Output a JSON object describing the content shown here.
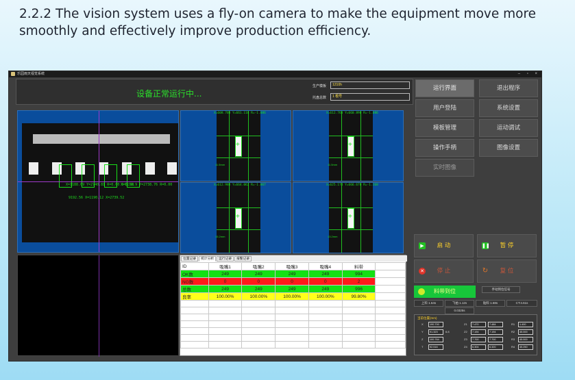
{
  "slide": {
    "heading": "2.2.2 The vision system uses a fly-on camera to make the equipment move more smoothly and effectively improve production efficiency."
  },
  "app": {
    "title": "乐园雨天视觉系统",
    "window_controls": "– ▫ ×",
    "status": "设备正常运行中...",
    "fields": [
      {
        "label": "生产模板",
        "value": "1210h"
      },
      {
        "label": "托盘总数",
        "value": "1 根号"
      }
    ],
    "nav": [
      {
        "label": "运行界面",
        "active": true
      },
      {
        "label": "退出程序"
      },
      {
        "label": "用户登陆"
      },
      {
        "label": "系统设置"
      },
      {
        "label": "模板管理"
      },
      {
        "label": "运动调试"
      },
      {
        "label": "操作手柄"
      },
      {
        "label": "图像设置"
      },
      {
        "label": "实时图像",
        "disabled": true
      }
    ],
    "main_camera": {
      "readout_a": "X=1188.09 Y=2740.81 R=0.00 S=0.98",
      "readout_b": "X=1219.9 Y=2738.76 R=0.00",
      "readout_c": "9192.56 X=1190.12 X=2739.52"
    },
    "sub_cameras": [
      {
        "readout": "X=608.703 Y=661.118 R=-1.086",
        "side": "11.5mm"
      },
      {
        "readout": "X=612.760 Y=660.890 R=-1.086",
        "side": "11.5mm"
      },
      {
        "readout": "X=612.988 Y=664.062 R=-1.067",
        "side": "15.2mm"
      },
      {
        "readout": "X=625.174 Y=666.670 R=-1.168",
        "side": "13.2mm"
      }
    ],
    "tabs": [
      "位置记录",
      "统计分析",
      "运行记录",
      "报警记录"
    ],
    "stats_table": {
      "headers": [
        "ID",
        "吸嘴1",
        "吸嘴2",
        "吸嘴3",
        "吸嘴4",
        "料带"
      ],
      "rows": [
        {
          "label": "OK数",
          "values": [
            "249",
            "249",
            "249",
            "249",
            "994"
          ]
        },
        {
          "label": "NG数",
          "values": [
            "0",
            "0",
            "0",
            "0",
            "2"
          ]
        },
        {
          "label": "总数",
          "values": [
            "249",
            "249",
            "249",
            "249",
            "996"
          ]
        },
        {
          "label": "良率",
          "values": [
            "100.00%",
            "100.00%",
            "100.00%",
            "100.00%",
            "99.80%"
          ]
        }
      ]
    },
    "controls": {
      "start": "启 动",
      "pause": "暂 停",
      "stop": "停 止",
      "reset": "复 位",
      "belt": "料带到位",
      "signal": "手动到位信号"
    },
    "timings": [
      "上料 1.64s",
      "飞拍 1.12s",
      "贴料 1.68s",
      "CT:4.61s",
      "0.0325s"
    ],
    "position_panel": {
      "title": "当前位置(mm)",
      "rows": [
        {
          "label": "X",
          "value": "190.700"
        },
        {
          "label": "Y",
          "value": "91.323"
        },
        {
          "label": "Z",
          "value": "100.764"
        },
        {
          "label": "T",
          "value": "92.516"
        }
      ],
      "extra": "6.8",
      "z_values": [
        "7.470",
        "7.194",
        "7.700",
        "6.304"
      ],
      "mid_values": [
        "7.484",
        "7.194",
        "7.700",
        "6.320"
      ],
      "r_values": [
        "1.400",
        "45.000",
        "45.000",
        "45.250"
      ],
      "z_labels": [
        "Z1",
        "Z2",
        "Z3",
        "Z4"
      ],
      "r_labels": [
        "R1",
        "R2",
        "R3",
        "R4"
      ]
    }
  }
}
